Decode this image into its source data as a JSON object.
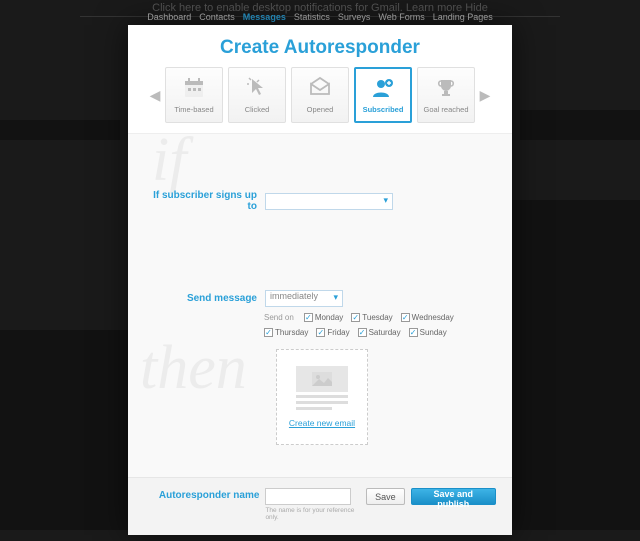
{
  "nav": {
    "items": [
      "Dashboard",
      "Contacts",
      "Messages",
      "Statistics",
      "Surveys",
      "Web Forms",
      "Landing Pages"
    ],
    "activeIndex": 2
  },
  "modal": {
    "title": "Create Autoresponder",
    "types": [
      {
        "label": "Time-based",
        "icon": "calendar"
      },
      {
        "label": "Clicked",
        "icon": "cursor"
      },
      {
        "label": "Opened",
        "icon": "envelope"
      },
      {
        "label": "Subscribed",
        "icon": "user"
      },
      {
        "label": "Goal reached",
        "icon": "trophy"
      }
    ],
    "selectedTypeIndex": 3,
    "if_label": "If subscriber signs up to",
    "campaign_value": "",
    "send_label": "Send message",
    "send_value": "immediately",
    "days_label": "Send on",
    "days": [
      {
        "label": "Monday",
        "checked": true
      },
      {
        "label": "Tuesday",
        "checked": true
      },
      {
        "label": "Wednesday",
        "checked": true
      },
      {
        "label": "Thursday",
        "checked": true
      },
      {
        "label": "Friday",
        "checked": true
      },
      {
        "label": "Saturday",
        "checked": true
      },
      {
        "label": "Sunday",
        "checked": true
      }
    ],
    "create_email_link": "Create new email",
    "name_label": "Autoresponder name",
    "name_value": "",
    "name_hint": "The name is for your reference only.",
    "save_btn": "Save",
    "publish_btn": "Save and publish",
    "watermarks": {
      "if": "if",
      "then": "then"
    }
  },
  "bg_hint": "Click here to enable desktop notifications for Gmail.   Learn more   Hide"
}
